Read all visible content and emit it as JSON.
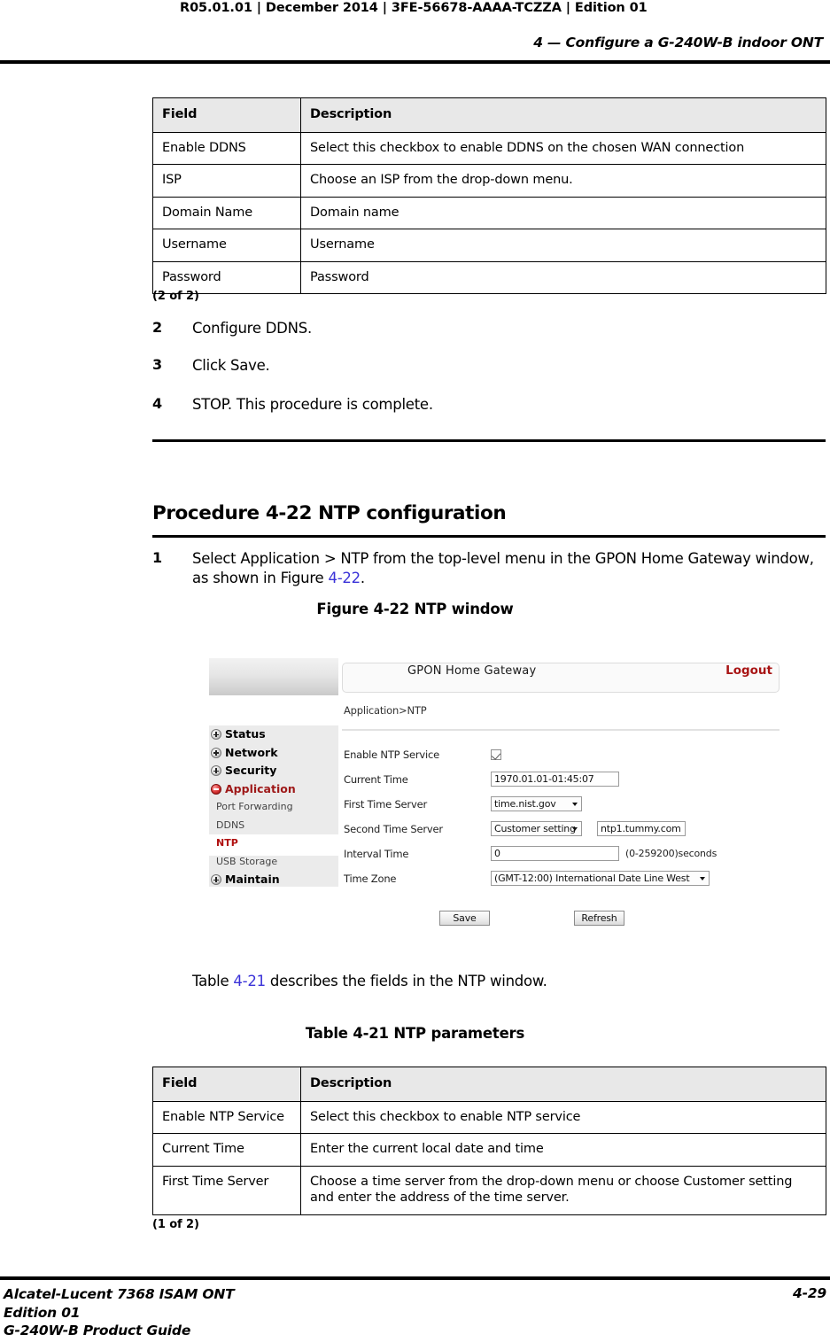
{
  "header": {
    "doc_id": "R05.01.01 | December 2014 | 3FE-56678-AAAA-TCZZA | Edition 01",
    "chapter": "4 —  Configure a G-240W-B indoor ONT"
  },
  "table_ddns": {
    "columns": [
      "Field",
      "Description"
    ],
    "rows": [
      [
        "Enable DDNS",
        "Select this checkbox to enable DDNS on the chosen WAN connection"
      ],
      [
        "ISP",
        "Choose an ISP from the drop-down menu."
      ],
      [
        "Domain Name",
        "Domain name"
      ],
      [
        "Username",
        "Username"
      ],
      [
        "Password",
        "Password"
      ]
    ],
    "continued": "(2 of 2)"
  },
  "steps_prev": [
    {
      "num": "2",
      "text": "Configure DDNS."
    },
    {
      "num": "3",
      "text": "Click Save."
    },
    {
      "num": "4",
      "text": "STOP. This procedure is complete."
    }
  ],
  "procedure": {
    "heading": "Procedure 4-22  NTP configuration",
    "step1_num": "1",
    "step1_text_a": "Select Application > NTP from the top-level menu in the GPON Home Gateway window, as shown in Figure ",
    "step1_xref": "4-22",
    "step1_text_b": "."
  },
  "figure": {
    "caption": "Figure 4-22  NTP window",
    "ui": {
      "title": "GPON Home Gateway",
      "logout": "Logout",
      "breadcrumb": "Application>NTP",
      "menu": [
        {
          "label": "Status",
          "type": "top",
          "toggle": "plus"
        },
        {
          "label": "Network",
          "type": "top",
          "toggle": "plus"
        },
        {
          "label": "Security",
          "type": "top",
          "toggle": "plus"
        },
        {
          "label": "Application",
          "type": "active-parent",
          "toggle": "minus"
        },
        {
          "label": "Port Forwarding",
          "type": "sub",
          "toggle": "none"
        },
        {
          "label": "DDNS",
          "type": "sub",
          "toggle": "none"
        },
        {
          "label": "NTP",
          "type": "active-leaf",
          "toggle": "none"
        },
        {
          "label": "USB Storage",
          "type": "sub",
          "toggle": "none"
        },
        {
          "label": "Maintain",
          "type": "top",
          "toggle": "plus"
        }
      ],
      "fields": {
        "enable_ntp_label": "Enable NTP Service",
        "enable_ntp_checked": true,
        "current_time_label": "Current Time",
        "current_time_value": "1970.01.01-01:45:07",
        "first_time_server_label": "First Time Server",
        "first_time_server_value": "time.nist.gov",
        "second_time_server_label": "Second Time Server",
        "second_time_server_value": "Customer setting",
        "second_time_server_custom": "ntp1.tummy.com",
        "interval_time_label": "Interval Time",
        "interval_time_value": "0",
        "interval_time_hint": "(0-259200)seconds",
        "time_zone_label": "Time Zone",
        "time_zone_value": "(GMT-12:00) International Date Line West"
      },
      "buttons": {
        "save": "Save",
        "refresh": "Refresh"
      }
    }
  },
  "table_ref_para_a": "Table ",
  "table_ref_xref": "4-21",
  "table_ref_para_b": " describes the fields in the NTP window.",
  "table_ntp": {
    "caption": "Table 4-21 NTP parameters",
    "columns": [
      "Field",
      "Description"
    ],
    "rows": [
      [
        "Enable NTP Service",
        "Select this checkbox to enable NTP service"
      ],
      [
        "Current Time",
        "Enter the current local date and time"
      ],
      [
        "First Time Server",
        "Choose a time server from the drop-down menu or choose Customer setting and enter the address of the time server."
      ]
    ],
    "continued": "(1 of 2)"
  },
  "footer": {
    "line1": "Alcatel-Lucent 7368 ISAM ONT",
    "line2": "Edition 01",
    "line3": "G-240W-B Product Guide",
    "page": "4-29"
  }
}
